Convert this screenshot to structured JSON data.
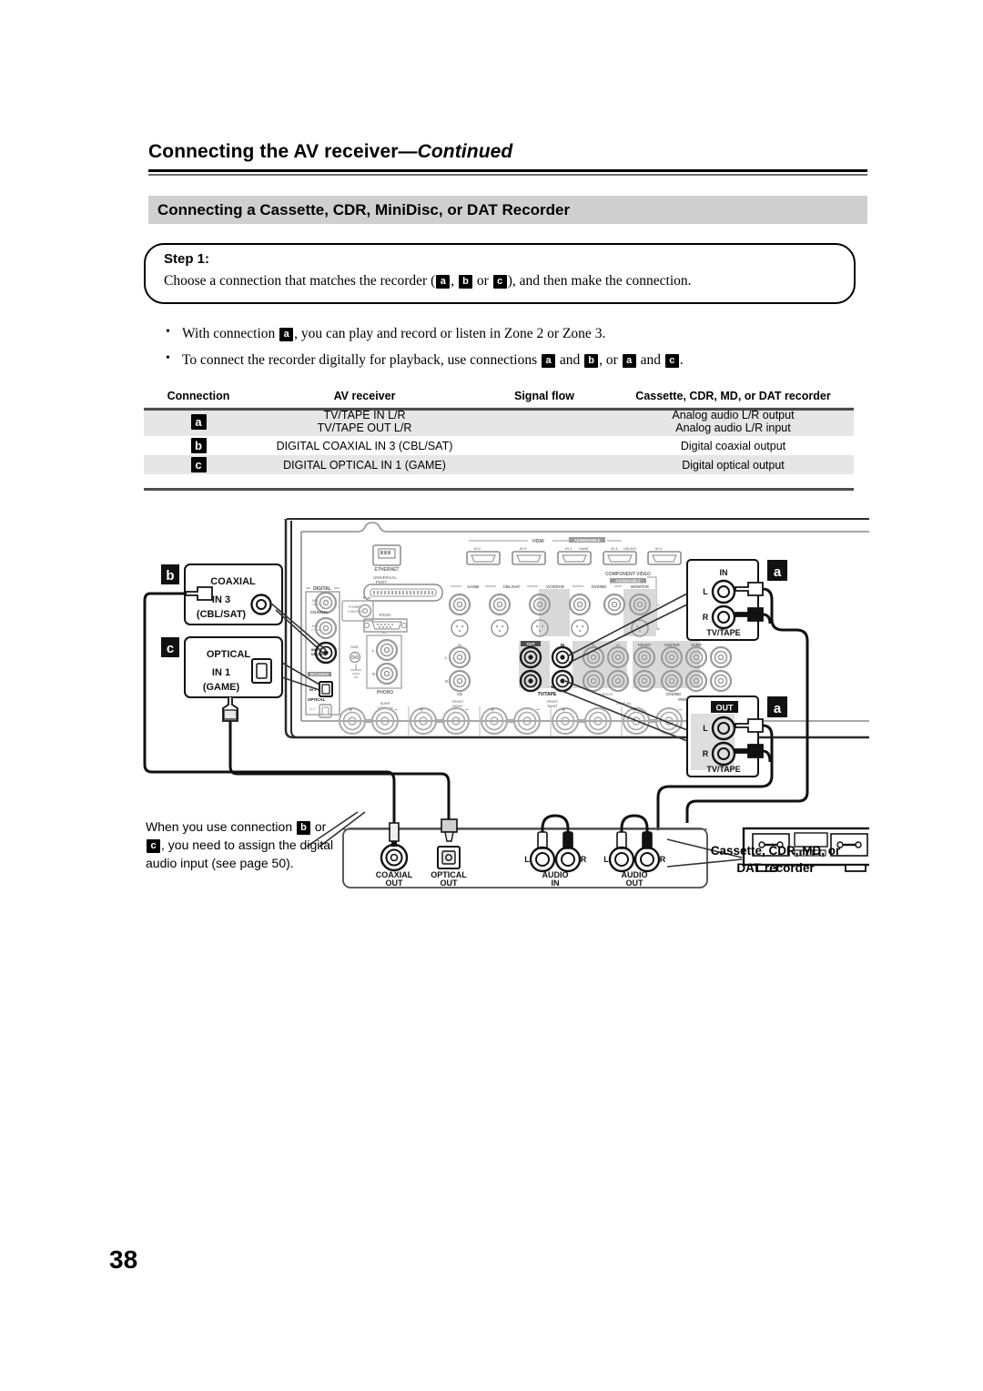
{
  "header": {
    "running_title": "Connecting the AV receiver",
    "running_title_continued": "—Continued",
    "section_title": "Connecting a Cassette, CDR, MiniDisc, or DAT Recorder"
  },
  "step": {
    "label": "Step 1:",
    "text_before": "Choose a connection that matches the recorder (",
    "badge_a": "a",
    "sep1": ", ",
    "badge_b": "b",
    "sep2": " or ",
    "badge_c": "c",
    "text_after": "), and then make the connection."
  },
  "bullets": [
    {
      "parts": [
        "With connection ",
        "a",
        ", you can play and record or listen in Zone 2 or Zone 3."
      ]
    },
    {
      "parts": [
        "To connect the recorder digitally for playback, use connections ",
        "a",
        " and ",
        "b",
        ", or ",
        "a",
        " and ",
        "c",
        "."
      ]
    }
  ],
  "table": {
    "headers": [
      "Connection",
      "AV receiver",
      "Signal flow",
      "Cassette, CDR, MD, or DAT recorder"
    ],
    "rows": [
      {
        "connection": "a",
        "av_receiver": [
          "TV/TAPE IN L/R",
          "TV/TAPE OUT L/R"
        ],
        "signal_flow": "",
        "recorder": [
          "Analog audio L/R output",
          "Analog audio L/R input"
        ],
        "shaded": true
      },
      {
        "connection": "b",
        "av_receiver": [
          "DIGITAL COAXIAL IN 3 (CBL/SAT)"
        ],
        "signal_flow": "",
        "recorder": [
          "Digital coaxial output"
        ],
        "shaded": false
      },
      {
        "connection": "c",
        "av_receiver": [
          "DIGITAL OPTICAL IN 1 (GAME)"
        ],
        "signal_flow": "",
        "recorder": [
          "Digital optical output"
        ],
        "shaded": true
      }
    ]
  },
  "diagram": {
    "callout_b": {
      "badge": "b",
      "line1": "COAXIAL",
      "line2": "IN 3",
      "line3": "(CBL/SAT)"
    },
    "callout_c": {
      "badge": "c",
      "line1": "OPTICAL",
      "line2": "IN 1",
      "line3": "(GAME)"
    },
    "callout_a_in": {
      "badge": "a",
      "top": "IN",
      "left_l": "L",
      "left_r": "R",
      "bottom": "TV/TAPE"
    },
    "callout_a_out": {
      "badge": "a",
      "top": "OUT",
      "left_l": "L",
      "left_r": "R",
      "bottom": "TV/TAPE"
    },
    "receiver_panel": {
      "ethernet": "ETHERNET",
      "universal_port": "UNIVERSAL PORT",
      "rs232": "RS232",
      "power_control": "POWER CONTROL",
      "ir_in": "IR IN",
      "digital": "DIGITAL",
      "coaxial": "COAXIAL",
      "optical": "OPTICAL",
      "gnd": "GND",
      "phono": "PHONO",
      "cd": "CD",
      "tv_tape": "TV/TAPE",
      "hdmi": "HDMI",
      "component_video": "COMPONENT VIDEO",
      "monitor_out": "MONITOR OUT",
      "pre_out": "PRE OUT",
      "front": "FRONT",
      "center": "CENTER",
      "surr": "SURR",
      "game": "GAME",
      "cbl_sat": "CBL/SAT",
      "vcr_dvr": "VCR/DVR",
      "dvd_bd": "DVD/BD",
      "in_labels": [
        "IN 6",
        "IN 5",
        "IN 4",
        "IN 3",
        "IN 2"
      ],
      "digital_in": [
        "IN 1",
        "IN 2",
        "IN 3"
      ],
      "optical_in": [
        "IN 1",
        "IN 2"
      ],
      "surr_back": "SURR BACK",
      "front_right": "FRONT RIGHT"
    },
    "recorder_panel": {
      "coaxial_out": [
        "COAXIAL",
        "OUT"
      ],
      "optical_out": [
        "OPTICAL",
        "OUT"
      ],
      "audio_in": [
        "AUDIO",
        "IN"
      ],
      "audio_out": [
        "AUDIO",
        "OUT"
      ],
      "l": "L",
      "r": "R"
    },
    "recorder_caption": [
      "Cassette, CDR, MD, or",
      "DAT recorder"
    ],
    "note": {
      "parts": [
        "When you use connection ",
        "b",
        " or ",
        "c",
        ", you need to assign the digital audio input (see page 50)."
      ]
    }
  },
  "page_number": "38",
  "colors": {
    "section_bar": "#cfcfcf",
    "table_shade": "#e6e6e6",
    "rule": "#4d4d4d",
    "panel_gray": "#9a9a9a",
    "panel_shade": "#d9d9d9"
  }
}
